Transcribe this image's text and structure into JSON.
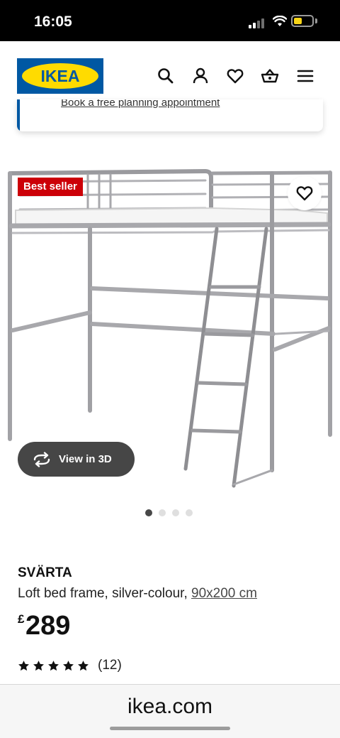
{
  "status_bar": {
    "time": "16:05",
    "battery_level": 0.45
  },
  "header": {
    "logo_text": "IKEA",
    "icons": [
      "search-icon",
      "account-icon",
      "heart-icon",
      "basket-icon",
      "menu-icon"
    ]
  },
  "notice": {
    "link_text": "Book a free planning appointment"
  },
  "product_image": {
    "badge": "Best seller",
    "view_3d_label": "View in 3D",
    "carousel_index": 1,
    "carousel_count": 4
  },
  "product": {
    "name": "SVÄRTA",
    "description": "Loft bed frame, silver-colour, ",
    "size": "90x200 cm",
    "currency": "£",
    "price": "289",
    "rating": 5,
    "reviews": "(12)"
  },
  "browser": {
    "url": "ikea.com"
  },
  "colors": {
    "brand_blue": "#0058a3",
    "brand_yellow": "#ffdb00",
    "badge_red": "#cc0008"
  }
}
